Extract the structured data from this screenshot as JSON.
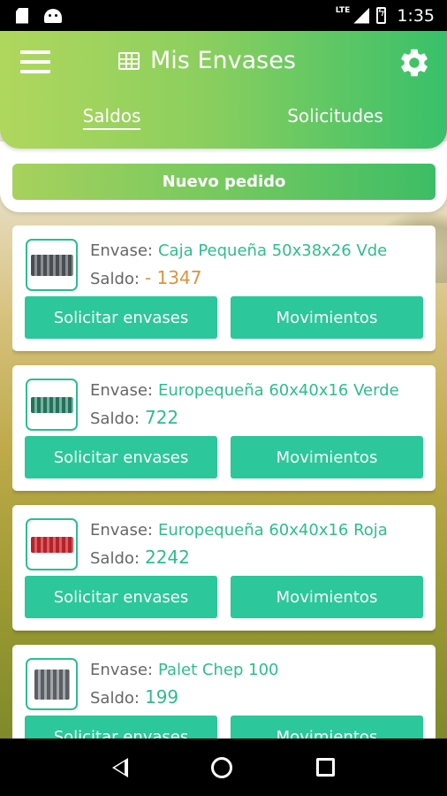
{
  "status_bar": {
    "network": "LTE",
    "time": "1:35"
  },
  "header": {
    "title": "Mis Envases",
    "tabs": [
      {
        "label": "Saldos",
        "active": true
      },
      {
        "label": "Solicitudes",
        "active": false
      }
    ]
  },
  "new_order_label": "Nuevo pedido",
  "labels": {
    "envase": "Envase:",
    "saldo": "Saldo:",
    "request_button": "Solicitar envases",
    "movements_button": "Movimientos"
  },
  "items": [
    {
      "name": "Caja Pequeña 50x38x26 Vde",
      "saldo": "- 1347",
      "image": "grey-crate"
    },
    {
      "name": "Europequeña 60x40x16 Verde",
      "saldo": "722",
      "image": "green-crate"
    },
    {
      "name": "Europequeña 60x40x16 Roja",
      "saldo": "2242",
      "image": "red-crate"
    },
    {
      "name": "Palet Chep 100",
      "saldo": "199",
      "image": "grey-tall-crate"
    }
  ],
  "colors": {
    "accent": "#2cc79a",
    "header_gradient_start": "#b0d75d",
    "header_gradient_end": "#38c06a",
    "negative_balance": "#e0913d"
  },
  "icons": {
    "menu": "hamburger-menu-icon",
    "title": "table-icon",
    "settings": "gear-icon",
    "nav_back": "back-triangle-icon",
    "nav_home": "home-circle-icon",
    "nav_recent": "recent-apps-square-icon"
  }
}
